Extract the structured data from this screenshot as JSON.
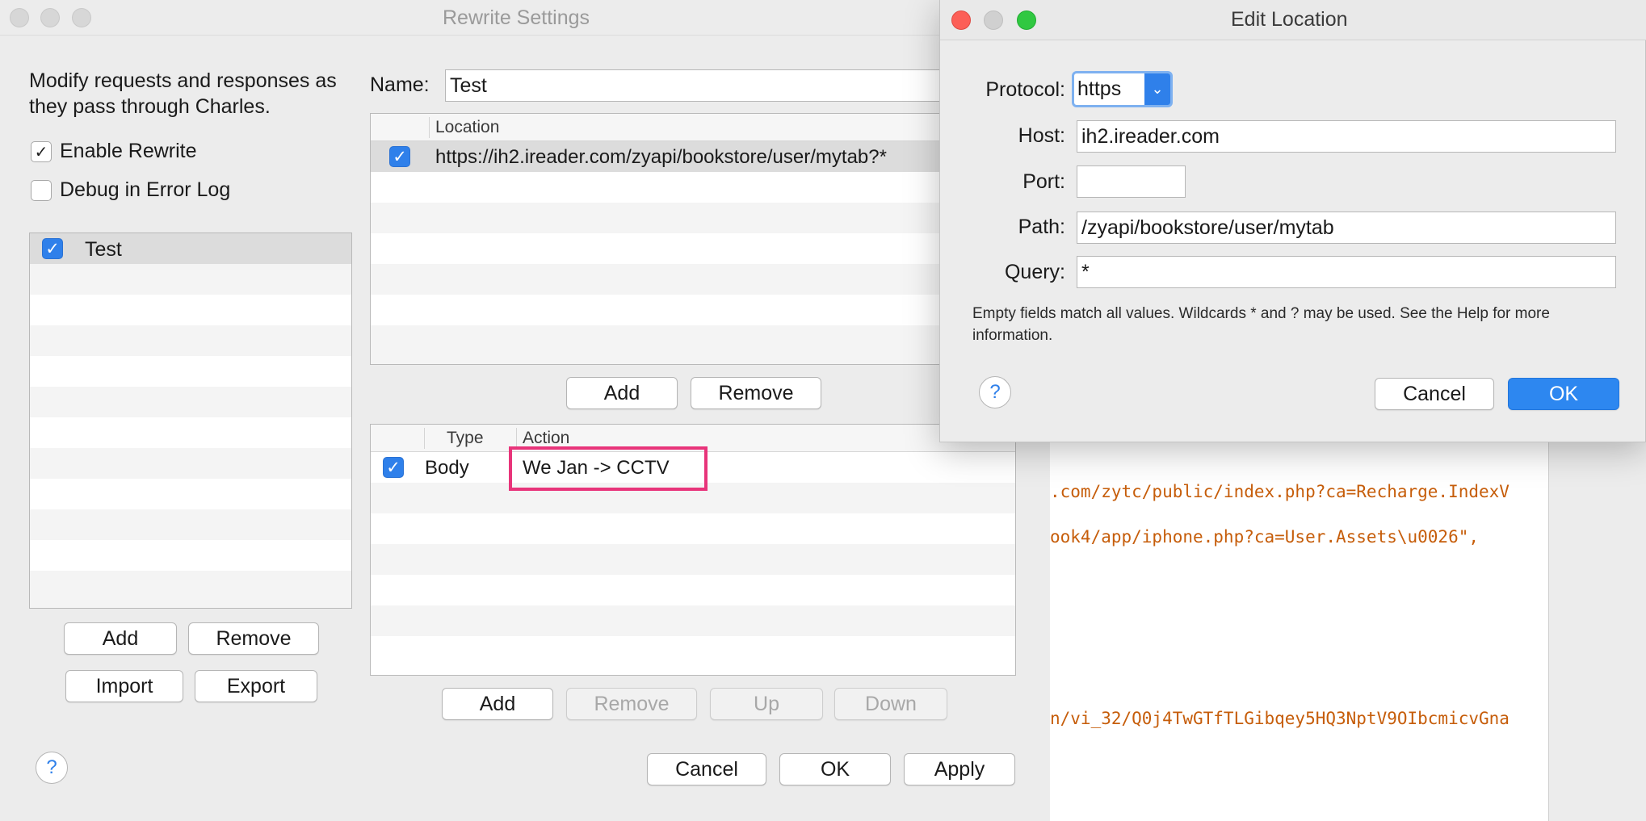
{
  "main_window": {
    "title": "Rewrite Settings",
    "description": "Modify requests and responses as they pass through Charles.",
    "enable_rewrite_label": "Enable Rewrite",
    "debug_label": "Debug in Error Log",
    "sets": [
      {
        "name": "Test",
        "checked": true
      }
    ],
    "sets_buttons": {
      "add": "Add",
      "remove": "Remove",
      "import": "Import",
      "export": "Export"
    },
    "name_label": "Name:",
    "name_value": "Test",
    "location_header": "Location",
    "locations": [
      {
        "url": "https://ih2.ireader.com/zyapi/bookstore/user/mytab?*",
        "checked": true
      }
    ],
    "location_buttons": {
      "add": "Add",
      "remove": "Remove"
    },
    "rules_headers": {
      "type": "Type",
      "action": "Action"
    },
    "rules": [
      {
        "type": "Body",
        "action": "We Jan -> CCTV",
        "checked": true
      }
    ],
    "rules_buttons": {
      "add": "Add",
      "remove": "Remove",
      "up": "Up",
      "down": "Down"
    },
    "footer_buttons": {
      "cancel": "Cancel",
      "ok": "OK",
      "apply": "Apply"
    },
    "help_label": "?"
  },
  "background_editor": {
    "lines": [
      ".com/zytc/public/index.php?ca=Recharge.IndexV",
      "ook4/app/iphone.php?ca=User.Assets\\u0026\",",
      "n/vi_32/Q0j4TwGTfTLGibqey5HQ3NptV9OIbcmicvGna"
    ]
  },
  "edit_location": {
    "title": "Edit Location",
    "protocol_label": "Protocol:",
    "protocol_value": "https",
    "host_label": "Host:",
    "host_value": "ih2.ireader.com",
    "port_label": "Port:",
    "port_value": "",
    "path_label": "Path:",
    "path_value": "/zyapi/bookstore/user/mytab",
    "query_label": "Query:",
    "query_value": "*",
    "note": "Empty fields match all values. Wildcards * and ? may be used. See the Help for more information.",
    "cancel": "Cancel",
    "ok": "OK",
    "help_label": "?"
  },
  "colors": {
    "accent": "#2f80ea",
    "highlight_box": "#e8347a",
    "code_text": "#c65d0a",
    "close": "#fc5f57",
    "zoom": "#30c841"
  }
}
